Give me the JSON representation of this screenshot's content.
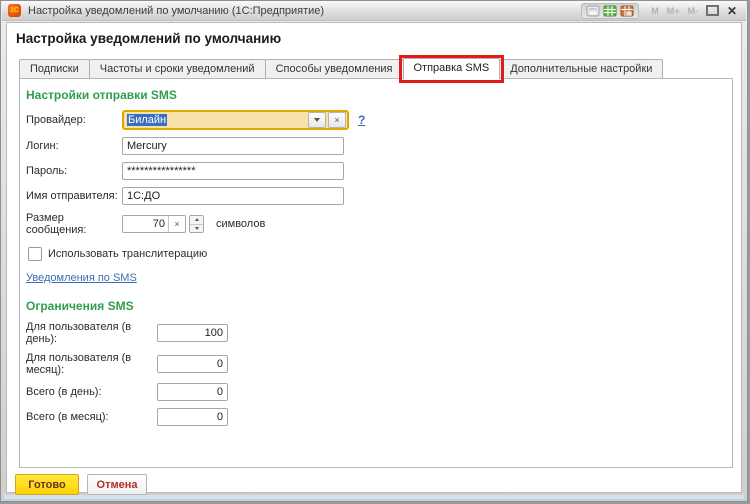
{
  "window": {
    "logo": "1С",
    "title": "Настройка уведомлений по умолчанию  (1С:Предприятие)",
    "memory_buttons": [
      "M",
      "M+",
      "M-"
    ],
    "icons": [
      "document-icon",
      "calendar-icon",
      "calendar-date-icon",
      "maximize-icon",
      "close-icon"
    ]
  },
  "header": {
    "title": "Настройка уведомлений по умолчанию"
  },
  "tabs": [
    {
      "label": "Подписки",
      "active": false
    },
    {
      "label": "Частоты и сроки уведомлений",
      "active": false
    },
    {
      "label": "Способы уведомления",
      "active": false
    },
    {
      "label": "Отправка SMS",
      "active": true,
      "annotated": true
    },
    {
      "label": "Дополнительные настройки",
      "active": false
    }
  ],
  "form": {
    "section1_title": "Настройки отправки SMS",
    "provider": {
      "label": "Провайдер:",
      "value": "Билайн",
      "help": "?"
    },
    "login": {
      "label": "Логин:",
      "value": "Mercury"
    },
    "password": {
      "label": "Пароль:",
      "value": "****************"
    },
    "sender": {
      "label": "Имя отправителя:",
      "value": "1С:ДО"
    },
    "size": {
      "label": "Размер сообщения:",
      "value": "70",
      "clear": "×",
      "suffix": "символов"
    },
    "transliteration": {
      "label": "Использовать транслитерацию",
      "checked": false
    },
    "link": "Уведомления по SMS",
    "section2_title": "Ограничения SMS",
    "limits": [
      {
        "label": "Для пользователя (в день):",
        "value": "100"
      },
      {
        "label": "Для пользователя (в месяц):",
        "value": "0"
      },
      {
        "label": "Всего (в день):",
        "value": "0"
      },
      {
        "label": "Всего (в месяц):",
        "value": "0"
      }
    ]
  },
  "footer": {
    "done": "Готово",
    "cancel": "Отмена"
  },
  "colors": {
    "section_green": "#2f9e4f",
    "annotation_red": "#e21b1b",
    "field_highlight_bg": "#f9e2a9",
    "field_highlight_border": "#dfa700",
    "selection_blue": "#3b6fbd",
    "link_blue": "#3a6eb5",
    "done_yellow": "#ffd400",
    "cancel_red": "#b03026"
  }
}
